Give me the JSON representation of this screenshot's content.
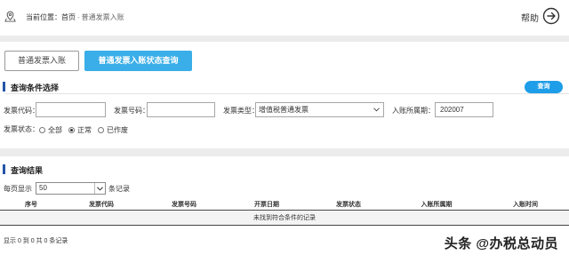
{
  "header": {
    "location_label": "当前位置：",
    "breadcrumb": [
      "首页",
      "普通发票入账"
    ],
    "separator": "-",
    "help_label": "帮助"
  },
  "tabs": [
    {
      "label": "普通发票入账",
      "active": false
    },
    {
      "label": "普通发票入账状态查询",
      "active": true
    }
  ],
  "query_section": {
    "title": "查询条件选择",
    "query_button": "查询",
    "fields": {
      "invoice_code_label": "发票代码：",
      "invoice_code_value": "",
      "invoice_number_label": "发票号码：",
      "invoice_number_value": "",
      "invoice_type_label": "发票类型：",
      "invoice_type_value": "增值税普通发票",
      "period_label": "入账所属期：",
      "period_value": "202007"
    },
    "status": {
      "label": "发票状态：",
      "options": [
        {
          "label": "全部",
          "selected": false
        },
        {
          "label": "正常",
          "selected": true
        },
        {
          "label": "已作废",
          "selected": false
        }
      ]
    }
  },
  "result_section": {
    "title": "查询结果",
    "per_page_label": "每页显示",
    "per_page_value": "50",
    "per_page_suffix": "条记录",
    "columns": [
      "序号",
      "发票代码",
      "发票号码",
      "开票日期",
      "发票状态",
      "入账所属期",
      "入账时间"
    ],
    "empty_message": "未找到符合条件的记录",
    "summary": "显示 0 到 0 共 0 条记录"
  },
  "watermark": "头条 @办税总动员",
  "colors": {
    "accent": "#3aaee8",
    "query_button": "#1e9de8",
    "section_marker": "#2455a6"
  }
}
